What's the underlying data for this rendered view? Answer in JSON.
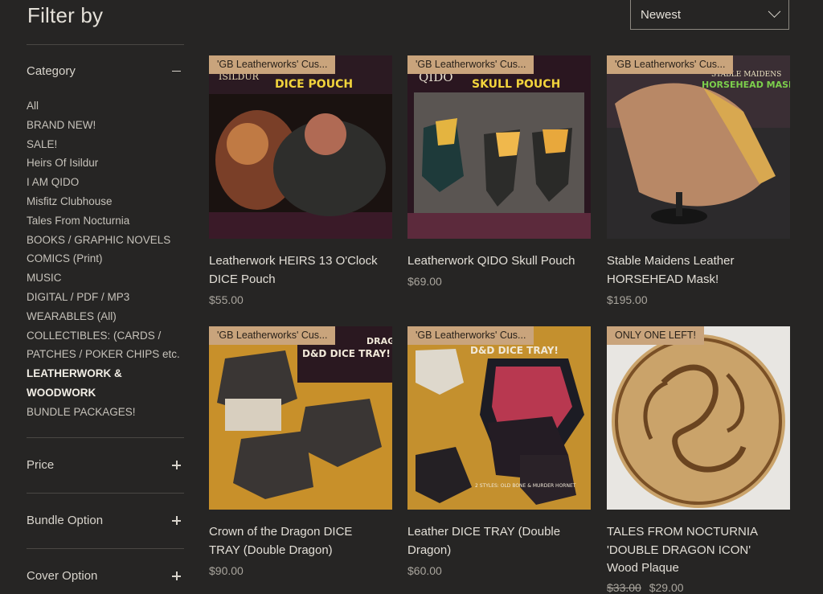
{
  "filter": {
    "title": "Filter by",
    "category": {
      "label": "Category",
      "items": [
        "All",
        "BRAND NEW!",
        "SALE!",
        "Heirs Of Isildur",
        "I AM QIDO",
        "Misfitz Clubhouse",
        "Tales From Nocturnia",
        "BOOKS / GRAPHIC NOVELS",
        "COMICS (Print)",
        "MUSIC",
        "DIGITAL / PDF / MP3",
        "WEARABLES (All)",
        "COLLECTIBLES: (CARDS /",
        "PATCHES / POKER CHIPS etc.",
        "LEATHERWORK &",
        "WOODWORK",
        "BUNDLE PACKAGES!"
      ],
      "active_items": [
        "LEATHERWORK &",
        "WOODWORK"
      ]
    },
    "price_label": "Price",
    "bundle_label": "Bundle Option",
    "cover_label": "Cover Option"
  },
  "sort": {
    "selected": "Newest"
  },
  "products": [
    {
      "ribbon": "'GB Leatherworks' Cus...",
      "image_text": [
        "ISILDUR",
        "DICE POUCH"
      ],
      "name_lines": [
        "Leatherwork HEIRS 13 O'Clock",
        "DICE Pouch"
      ],
      "price": "$55.00"
    },
    {
      "ribbon": "'GB Leatherworks' Cus...",
      "image_text": [
        "QIDO",
        "SKULL POUCH"
      ],
      "name_lines": [
        "Leatherwork QIDO Skull Pouch"
      ],
      "price": "$69.00"
    },
    {
      "ribbon": "'GB Leatherworks' Cus...",
      "image_text": [
        "STABLE MAIDENS",
        "HORSEHEAD MASK"
      ],
      "name_lines": [
        "Stable Maidens Leather",
        "HORSEHEAD Mask!"
      ],
      "price": "$195.00"
    },
    {
      "ribbon": "'GB Leatherworks' Cus...",
      "image_text": [
        "DRAGON",
        "D&D DICE TRAY!"
      ],
      "name_lines": [
        "Crown of the Dragon DICE",
        "TRAY (Double Dragon)"
      ],
      "price": "$90.00"
    },
    {
      "ribbon": "'GB Leatherworks' Cus...",
      "image_text": [
        "D&D DICE TRAY!",
        "2 STYLES: OLD BONE & MURDER HORNET"
      ],
      "name_lines": [
        "Leather DICE TRAY (Double",
        "Dragon)"
      ],
      "price": "$60.00"
    },
    {
      "ribbon": "ONLY ONE LEFT!",
      "image_text": [],
      "name_lines": [
        "TALES FROM NOCTURNIA",
        "'DOUBLE DRAGON ICON'",
        "Wood Plaque"
      ],
      "old_price": "$33.00",
      "price": "$29.00"
    }
  ],
  "colors": {
    "background": "#262524",
    "ribbon": "#c9a47c",
    "text": "#d8d4cc"
  }
}
